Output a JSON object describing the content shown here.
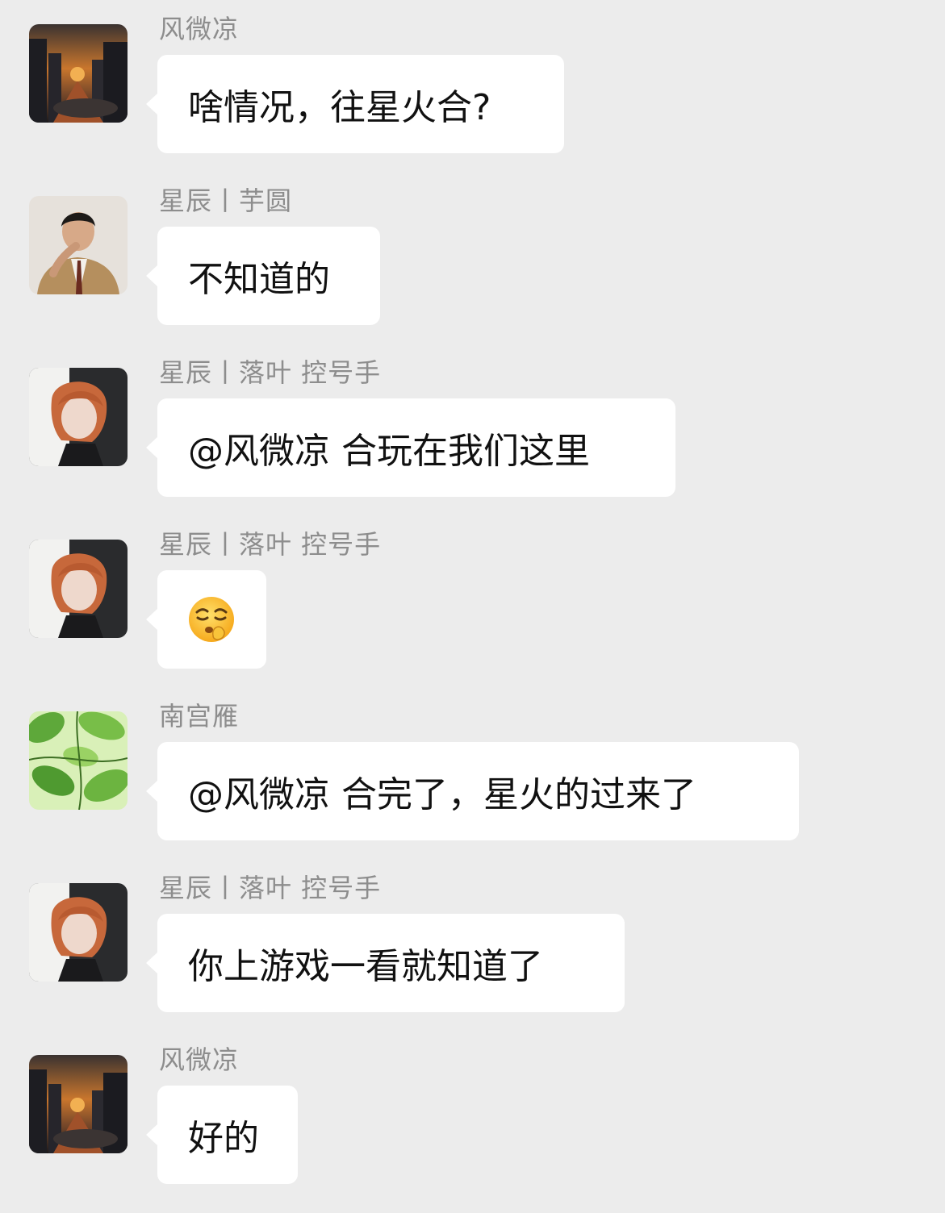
{
  "messages": [
    {
      "sender": "风微凉",
      "text": "啥情况，往星火合?",
      "avatar": "city-sunset-avatar"
    },
    {
      "sender": "星辰丨芋圆",
      "text": "不知道的",
      "avatar": "man-in-suit-avatar"
    },
    {
      "sender": "星辰丨落叶 控号手",
      "text": "@风微凉 合玩在我们这里",
      "avatar": "anime-redhead-avatar"
    },
    {
      "sender": "星辰丨落叶 控号手",
      "emoji": "hush-face-emoji",
      "avatar": "anime-redhead-avatar"
    },
    {
      "sender": "南宫雁",
      "text": "@风微凉 合完了，星火的过来了",
      "avatar": "green-leaves-avatar"
    },
    {
      "sender": "星辰丨落叶 控号手",
      "text": "你上游戏一看就知道了",
      "avatar": "anime-redhead-avatar"
    },
    {
      "sender": "风微凉",
      "text": "好的",
      "avatar": "city-sunset-avatar"
    }
  ]
}
